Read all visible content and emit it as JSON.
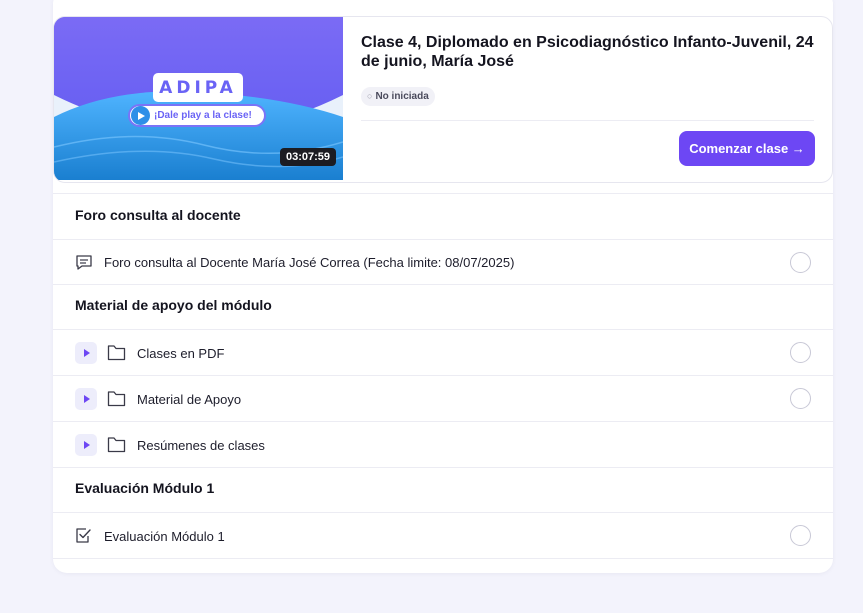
{
  "class": {
    "thumbnail_logo": "ADIPA",
    "thumbnail_play_text": "¡Dale play a la clase!",
    "duration": "03:07:59",
    "title": "Clase 4, Diplomado en Psicodiagnóstico Infanto-Juvenil, 24 de junio, María José",
    "status": "No iniciada",
    "start_button": "Comenzar clase →"
  },
  "sections": {
    "foro": {
      "title": "Foro consulta al docente",
      "item": "Foro consulta al Docente María José Correa (Fecha limite: 08/07/2025)",
      "item_icon": "chat-icon"
    },
    "material": {
      "title": "Material de apoyo del módulo",
      "items": [
        "Clases en PDF",
        "Material de Apoyo",
        "Resúmenes de clases"
      ],
      "item_icon": "folder-icon"
    },
    "evaluacion": {
      "title": "Evaluación Módulo 1",
      "item": "Evaluación Módulo 1",
      "item_icon": "checkbox-icon"
    }
  },
  "colors": {
    "accent": "#6d47f4",
    "background": "#f3f3fc"
  }
}
